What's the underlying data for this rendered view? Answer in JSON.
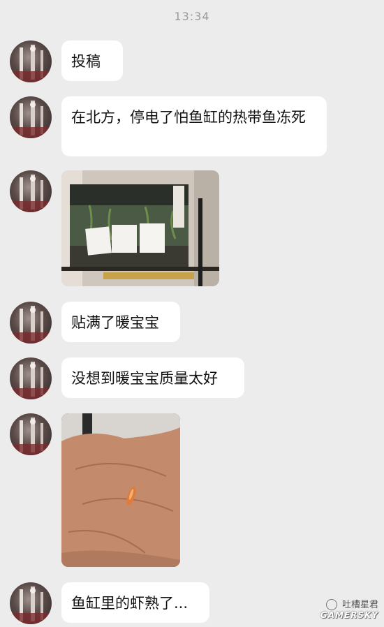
{
  "header": {
    "time": "13:34"
  },
  "messages": [
    {
      "type": "text",
      "text": "投稿"
    },
    {
      "type": "text",
      "text": "在北方，停电了怕鱼缸的热带鱼冻死"
    },
    {
      "type": "image",
      "image": "fish-tank-photo"
    },
    {
      "type": "text",
      "text": "贴满了暖宝宝"
    },
    {
      "type": "text",
      "text": "没想到暖宝宝质量太好"
    },
    {
      "type": "image",
      "image": "hand-with-cooked-shrimp-photo"
    },
    {
      "type": "text",
      "text": "鱼缸里的虾熟了..."
    }
  ],
  "watermark": {
    "account": "吐槽星君",
    "site": "GAMERSKY"
  },
  "colors": {
    "background": "#ececec",
    "bubble": "#ffffff",
    "text": "#111111",
    "time": "#9a9a9a"
  }
}
